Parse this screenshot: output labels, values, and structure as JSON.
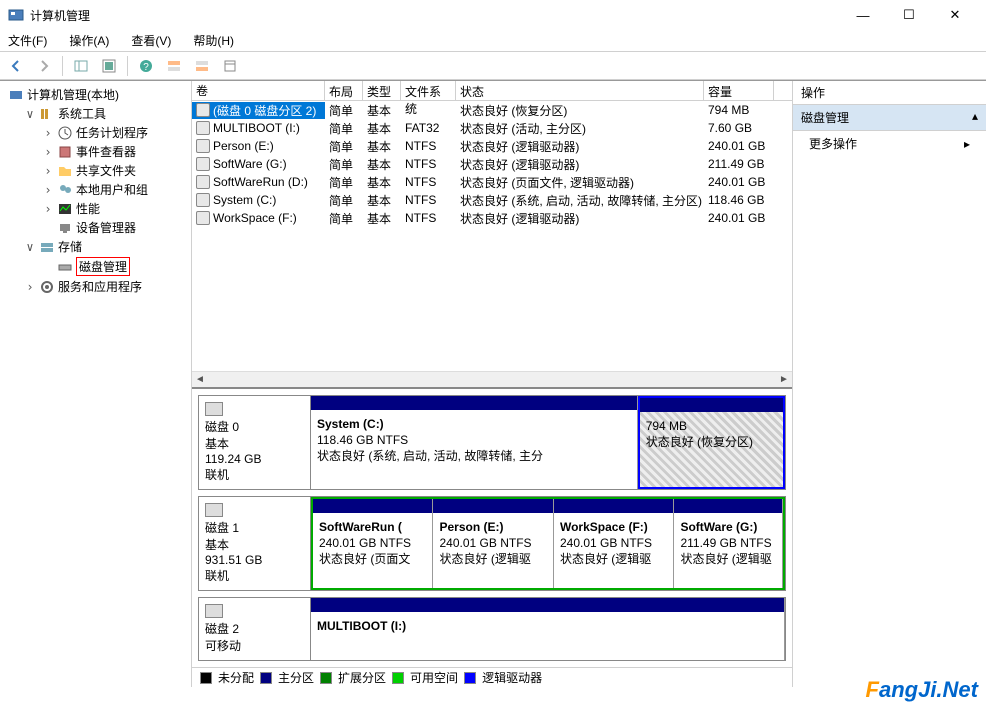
{
  "window": {
    "title": "计算机管理"
  },
  "menu": {
    "file": "文件(F)",
    "action": "操作(A)",
    "view": "查看(V)",
    "help": "帮助(H)"
  },
  "tree": {
    "root": "计算机管理(本地)",
    "systools": "系统工具",
    "sched": "任务计划程序",
    "eventvwr": "事件查看器",
    "shared": "共享文件夹",
    "users": "本地用户和组",
    "perf": "性能",
    "devmgr": "设备管理器",
    "storage": "存储",
    "diskmgmt": "磁盘管理",
    "services": "服务和应用程序"
  },
  "vol_headers": {
    "vol": "卷",
    "layout": "布局",
    "type": "类型",
    "fs": "文件系统",
    "status": "状态",
    "cap": "容量"
  },
  "volumes": [
    {
      "name": "(磁盘 0 磁盘分区 2)",
      "layout": "简单",
      "type": "基本",
      "fs": "",
      "status": "状态良好 (恢复分区)",
      "cap": "794 MB"
    },
    {
      "name": "MULTIBOOT (I:)",
      "layout": "简单",
      "type": "基本",
      "fs": "FAT32",
      "status": "状态良好 (活动, 主分区)",
      "cap": "7.60 GB"
    },
    {
      "name": "Person (E:)",
      "layout": "简单",
      "type": "基本",
      "fs": "NTFS",
      "status": "状态良好 (逻辑驱动器)",
      "cap": "240.01 GB"
    },
    {
      "name": "SoftWare  (G:)",
      "layout": "简单",
      "type": "基本",
      "fs": "NTFS",
      "status": "状态良好 (逻辑驱动器)",
      "cap": "211.49 GB"
    },
    {
      "name": "SoftWareRun (D:)",
      "layout": "简单",
      "type": "基本",
      "fs": "NTFS",
      "status": "状态良好 (页面文件, 逻辑驱动器)",
      "cap": "240.01 GB"
    },
    {
      "name": "System (C:)",
      "layout": "简单",
      "type": "基本",
      "fs": "NTFS",
      "status": "状态良好 (系统, 启动, 活动, 故障转储, 主分区)",
      "cap": "118.46 GB"
    },
    {
      "name": "WorkSpace (F:)",
      "layout": "简单",
      "type": "基本",
      "fs": "NTFS",
      "status": "状态良好 (逻辑驱动器)",
      "cap": "240.01 GB"
    }
  ],
  "disks": {
    "d0": {
      "title": "磁盘 0",
      "type": "基本",
      "size": "119.24 GB",
      "state": "联机",
      "p0": {
        "name": "System  (C:)",
        "sz": "118.46 GB NTFS",
        "st": "状态良好 (系统, 启动, 活动, 故障转储, 主分"
      },
      "p1": {
        "sz": "794 MB",
        "st": "状态良好 (恢复分区)"
      }
    },
    "d1": {
      "title": "磁盘 1",
      "type": "基本",
      "size": "931.51 GB",
      "state": "联机",
      "p0": {
        "name": "SoftWareRun  (",
        "sz": "240.01 GB NTFS",
        "st": "状态良好 (页面文"
      },
      "p1": {
        "name": "Person  (E:)",
        "sz": "240.01 GB NTFS",
        "st": "状态良好 (逻辑驱"
      },
      "p2": {
        "name": "WorkSpace  (F:)",
        "sz": "240.01 GB NTFS",
        "st": "状态良好 (逻辑驱"
      },
      "p3": {
        "name": "SoftWare  (G:)",
        "sz": "211.49 GB NTFS",
        "st": "状态良好 (逻辑驱"
      }
    },
    "d2": {
      "title": "磁盘 2",
      "type": "可移动",
      "p0": {
        "name": "MULTIBOOT  (I:)"
      }
    }
  },
  "legend": {
    "unalloc": "未分配",
    "primary": "主分区",
    "extended": "扩展分区",
    "free": "可用空间",
    "logical": "逻辑驱动器"
  },
  "actions": {
    "header": "操作",
    "sub": "磁盘管理",
    "more": "更多操作"
  },
  "watermark": {
    "f": "F",
    "rest": "angJi.Net"
  },
  "colors": {
    "navy": "#000080",
    "green": "#00a000",
    "lime": "#80ff80",
    "blue": "#0000ff",
    "black": "#000000"
  }
}
